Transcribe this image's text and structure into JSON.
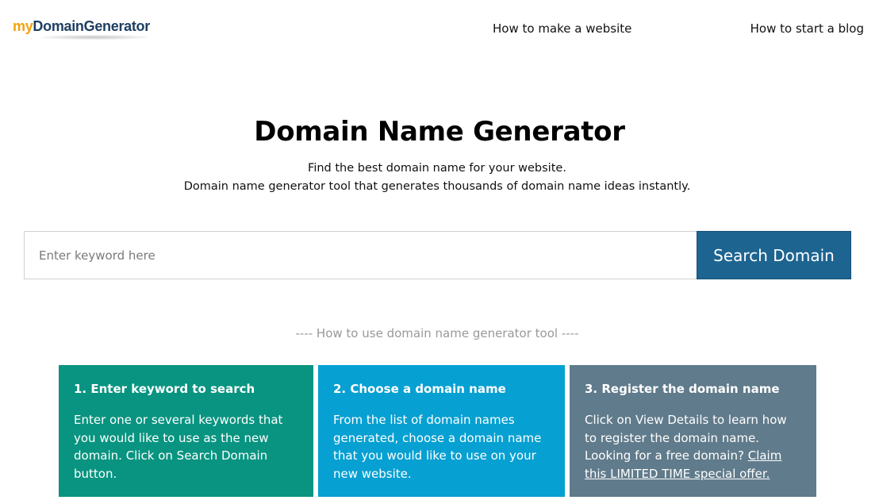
{
  "header": {
    "logo": {
      "my": "my",
      "rest": "DomainGenerator"
    },
    "nav": [
      {
        "label": "How to make a website"
      },
      {
        "label": "How to start a blog"
      }
    ]
  },
  "hero": {
    "title": "Domain Name Generator",
    "subtitle_line1": "Find the best domain name for your website.",
    "subtitle_line2": "Domain name generator tool that generates thousands of domain name ideas instantly."
  },
  "search": {
    "placeholder": "Enter keyword here",
    "value": "",
    "button_label": "Search Domain"
  },
  "howto": {
    "heading": "---- How to use domain name generator tool ----"
  },
  "steps": [
    {
      "title": "1. Enter keyword to search",
      "body": "Enter one or several keywords that you would like to use as the new domain. Click on Search Domain button."
    },
    {
      "title": "2. Choose a domain name",
      "body": "From the list of domain names generated, choose a domain name that you would like to use on your new website."
    },
    {
      "title": "3. Register the domain name",
      "body": "Click on View Details to learn how to register the domain name. Looking for a free domain?",
      "link": "Claim this LIMITED TIME special offer."
    }
  ],
  "colors": {
    "logo_my": "#f5a00f",
    "logo_rest": "#1f3f63",
    "search_button": "#1d6491",
    "step1": "#089480",
    "step2": "#06a0d2",
    "step3": "#607b8b",
    "howto_text": "#999999"
  }
}
